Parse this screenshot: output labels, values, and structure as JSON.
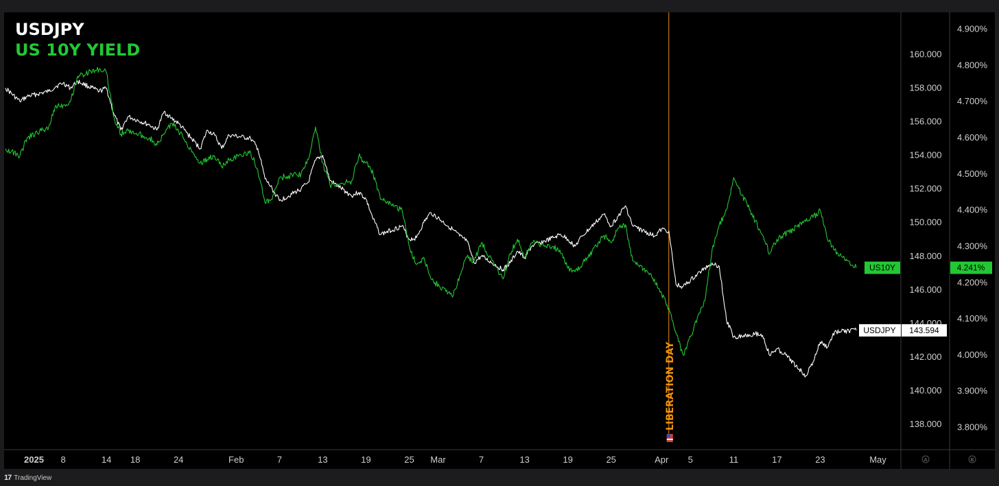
{
  "footer": {
    "brand": "TradingView",
    "logo_icon": "tradingview-logo-icon"
  },
  "chart_data": {
    "type": "line",
    "title": "USDJPY",
    "subtitle": "US 10Y YIELD",
    "x_tick_labels": [
      "2025",
      "8",
      "14",
      "18",
      "24",
      "Feb",
      "7",
      "13",
      "19",
      "25",
      "Mar",
      "7",
      "13",
      "19",
      "25",
      "Apr",
      "5",
      "11",
      "17",
      "23",
      "May"
    ],
    "x_tick_dates": [
      "2025-01-02",
      "2025-01-08",
      "2025-01-14",
      "2025-01-18",
      "2025-01-24",
      "2025-02-01",
      "2025-02-07",
      "2025-02-13",
      "2025-02-19",
      "2025-02-25",
      "2025-03-01",
      "2025-03-07",
      "2025-03-13",
      "2025-03-19",
      "2025-03-25",
      "2025-04-01",
      "2025-04-05",
      "2025-04-11",
      "2025-04-17",
      "2025-04-23",
      "2025-05-01"
    ],
    "x_range": [
      "2024-12-31",
      "2025-05-02"
    ],
    "y_left": {
      "label": "",
      "range": [
        136.5,
        162.5
      ],
      "ticks": [
        "138.000",
        "140.000",
        "142.000",
        "144.000",
        "146.000",
        "148.000",
        "150.000",
        "152.000",
        "154.000",
        "156.000",
        "158.000",
        "160.000"
      ]
    },
    "y_right": {
      "label": "",
      "range": [
        3.7385,
        4.9465
      ],
      "ticks": [
        "3.800%",
        "3.900%",
        "4.000%",
        "4.100%",
        "4.200%",
        "4.300%",
        "4.400%",
        "4.500%",
        "4.600%",
        "4.700%",
        "4.800%",
        "4.900%"
      ]
    },
    "grid": false,
    "series": [
      {
        "name": "USDJPY",
        "axis": "left",
        "color": "#ffffff",
        "last_value": "143.594",
        "label_bg": "#ffffff",
        "label_text": "#000000",
        "points": [
          [
            "2024-12-31",
            158.0
          ],
          [
            "2025-01-02",
            157.2
          ],
          [
            "2025-01-03",
            157.5
          ],
          [
            "2025-01-06",
            157.8
          ],
          [
            "2025-01-07",
            158.1
          ],
          [
            "2025-01-08",
            158.3
          ],
          [
            "2025-01-09",
            158.0
          ],
          [
            "2025-01-10",
            158.4
          ],
          [
            "2025-01-13",
            157.8
          ],
          [
            "2025-01-14",
            158.0
          ],
          [
            "2025-01-15",
            156.5
          ],
          [
            "2025-01-16",
            155.5
          ],
          [
            "2025-01-17",
            156.3
          ],
          [
            "2025-01-20",
            155.8
          ],
          [
            "2025-01-21",
            155.5
          ],
          [
            "2025-01-22",
            156.6
          ],
          [
            "2025-01-23",
            156.2
          ],
          [
            "2025-01-24",
            155.9
          ],
          [
            "2025-01-27",
            154.4
          ],
          [
            "2025-01-28",
            155.5
          ],
          [
            "2025-01-29",
            155.2
          ],
          [
            "2025-01-30",
            154.4
          ],
          [
            "2025-01-31",
            155.2
          ],
          [
            "2025-02-03",
            155.0
          ],
          [
            "2025-02-04",
            154.4
          ],
          [
            "2025-02-05",
            152.6
          ],
          [
            "2025-02-06",
            152.0
          ],
          [
            "2025-02-07",
            151.3
          ],
          [
            "2025-02-10",
            152.0
          ],
          [
            "2025-02-11",
            152.4
          ],
          [
            "2025-02-12",
            153.7
          ],
          [
            "2025-02-13",
            154.0
          ],
          [
            "2025-02-14",
            152.5
          ],
          [
            "2025-02-17",
            151.6
          ],
          [
            "2025-02-18",
            151.8
          ],
          [
            "2025-02-19",
            151.4
          ],
          [
            "2025-02-20",
            150.2
          ],
          [
            "2025-02-21",
            149.3
          ],
          [
            "2025-02-24",
            149.8
          ],
          [
            "2025-02-25",
            149.0
          ],
          [
            "2025-02-26",
            149.1
          ],
          [
            "2025-02-27",
            150.0
          ],
          [
            "2025-02-28",
            150.6
          ],
          [
            "2025-03-03",
            149.6
          ],
          [
            "2025-03-04",
            149.2
          ],
          [
            "2025-03-05",
            148.9
          ],
          [
            "2025-03-06",
            147.6
          ],
          [
            "2025-03-07",
            148.0
          ],
          [
            "2025-03-10",
            147.2
          ],
          [
            "2025-03-11",
            147.6
          ],
          [
            "2025-03-12",
            148.3
          ],
          [
            "2025-03-13",
            147.9
          ],
          [
            "2025-03-14",
            148.6
          ],
          [
            "2025-03-17",
            149.1
          ],
          [
            "2025-03-18",
            149.3
          ],
          [
            "2025-03-19",
            149.0
          ],
          [
            "2025-03-20",
            148.6
          ],
          [
            "2025-03-21",
            149.2
          ],
          [
            "2025-03-24",
            150.5
          ],
          [
            "2025-03-25",
            149.8
          ],
          [
            "2025-03-26",
            150.4
          ],
          [
            "2025-03-27",
            151.0
          ],
          [
            "2025-03-28",
            149.8
          ],
          [
            "2025-03-31",
            149.2
          ],
          [
            "2025-04-01",
            149.6
          ],
          [
            "2025-04-02",
            149.5
          ],
          [
            "2025-04-03",
            146.3
          ],
          [
            "2025-04-04",
            146.2
          ],
          [
            "2025-04-07",
            147.3
          ],
          [
            "2025-04-08",
            147.6
          ],
          [
            "2025-04-09",
            147.4
          ],
          [
            "2025-04-10",
            144.2
          ],
          [
            "2025-04-11",
            143.2
          ],
          [
            "2025-04-14",
            143.4
          ],
          [
            "2025-04-15",
            143.3
          ],
          [
            "2025-04-16",
            142.1
          ],
          [
            "2025-04-17",
            142.5
          ],
          [
            "2025-04-18",
            142.2
          ],
          [
            "2025-04-21",
            140.9
          ],
          [
            "2025-04-22",
            141.7
          ],
          [
            "2025-04-23",
            142.9
          ],
          [
            "2025-04-24",
            142.6
          ],
          [
            "2025-04-25",
            143.5
          ],
          [
            "2025-04-28",
            143.594
          ]
        ]
      },
      {
        "name": "US10Y",
        "axis": "right",
        "color": "#22c832",
        "last_value": "4.241%",
        "label_bg": "#22c832",
        "label_text": "#000000",
        "points": [
          [
            "2024-12-31",
            4.57
          ],
          [
            "2025-01-02",
            4.55
          ],
          [
            "2025-01-03",
            4.6
          ],
          [
            "2025-01-06",
            4.63
          ],
          [
            "2025-01-07",
            4.69
          ],
          [
            "2025-01-08",
            4.69
          ],
          [
            "2025-01-09",
            4.7
          ],
          [
            "2025-01-10",
            4.77
          ],
          [
            "2025-01-13",
            4.79
          ],
          [
            "2025-01-14",
            4.78
          ],
          [
            "2025-01-15",
            4.66
          ],
          [
            "2025-01-16",
            4.61
          ],
          [
            "2025-01-17",
            4.62
          ],
          [
            "2025-01-20",
            4.6
          ],
          [
            "2025-01-21",
            4.58
          ],
          [
            "2025-01-22",
            4.61
          ],
          [
            "2025-01-23",
            4.64
          ],
          [
            "2025-01-24",
            4.62
          ],
          [
            "2025-01-27",
            4.53
          ],
          [
            "2025-01-28",
            4.54
          ],
          [
            "2025-01-29",
            4.55
          ],
          [
            "2025-01-30",
            4.52
          ],
          [
            "2025-01-31",
            4.54
          ],
          [
            "2025-02-03",
            4.56
          ],
          [
            "2025-02-04",
            4.51
          ],
          [
            "2025-02-05",
            4.42
          ],
          [
            "2025-02-06",
            4.43
          ],
          [
            "2025-02-07",
            4.49
          ],
          [
            "2025-02-10",
            4.5
          ],
          [
            "2025-02-11",
            4.54
          ],
          [
            "2025-02-12",
            4.63
          ],
          [
            "2025-02-13",
            4.53
          ],
          [
            "2025-02-14",
            4.47
          ],
          [
            "2025-02-17",
            4.48
          ],
          [
            "2025-02-18",
            4.55
          ],
          [
            "2025-02-19",
            4.53
          ],
          [
            "2025-02-20",
            4.5
          ],
          [
            "2025-02-21",
            4.43
          ],
          [
            "2025-02-24",
            4.4
          ],
          [
            "2025-02-25",
            4.3
          ],
          [
            "2025-02-26",
            4.25
          ],
          [
            "2025-02-27",
            4.27
          ],
          [
            "2025-02-28",
            4.21
          ],
          [
            "2025-03-03",
            4.16
          ],
          [
            "2025-03-04",
            4.22
          ],
          [
            "2025-03-05",
            4.27
          ],
          [
            "2025-03-06",
            4.26
          ],
          [
            "2025-03-07",
            4.31
          ],
          [
            "2025-03-10",
            4.21
          ],
          [
            "2025-03-11",
            4.28
          ],
          [
            "2025-03-12",
            4.32
          ],
          [
            "2025-03-13",
            4.27
          ],
          [
            "2025-03-14",
            4.31
          ],
          [
            "2025-03-17",
            4.3
          ],
          [
            "2025-03-18",
            4.28
          ],
          [
            "2025-03-19",
            4.24
          ],
          [
            "2025-03-20",
            4.23
          ],
          [
            "2025-03-21",
            4.25
          ],
          [
            "2025-03-24",
            4.33
          ],
          [
            "2025-03-25",
            4.31
          ],
          [
            "2025-03-26",
            4.35
          ],
          [
            "2025-03-27",
            4.36
          ],
          [
            "2025-03-28",
            4.26
          ],
          [
            "2025-03-31",
            4.21
          ],
          [
            "2025-04-01",
            4.17
          ],
          [
            "2025-04-02",
            4.13
          ],
          [
            "2025-04-03",
            4.06
          ],
          [
            "2025-04-04",
            4.0
          ],
          [
            "2025-04-07",
            4.15
          ],
          [
            "2025-04-08",
            4.29
          ],
          [
            "2025-04-09",
            4.36
          ],
          [
            "2025-04-10",
            4.4
          ],
          [
            "2025-04-11",
            4.49
          ],
          [
            "2025-04-14",
            4.37
          ],
          [
            "2025-04-15",
            4.33
          ],
          [
            "2025-04-16",
            4.28
          ],
          [
            "2025-04-17",
            4.32
          ],
          [
            "2025-04-22",
            4.38
          ],
          [
            "2025-04-23",
            4.4
          ],
          [
            "2025-04-24",
            4.32
          ],
          [
            "2025-04-25",
            4.29
          ],
          [
            "2025-04-28",
            4.241
          ]
        ]
      }
    ],
    "annotations": [
      {
        "type": "vertical-line",
        "date": "2025-04-02",
        "label": "LIBERATION DAY",
        "color": "#f0900a",
        "icon": "us-flag-icon"
      }
    ],
    "scale_mode_labels": [
      "A",
      "B"
    ]
  }
}
